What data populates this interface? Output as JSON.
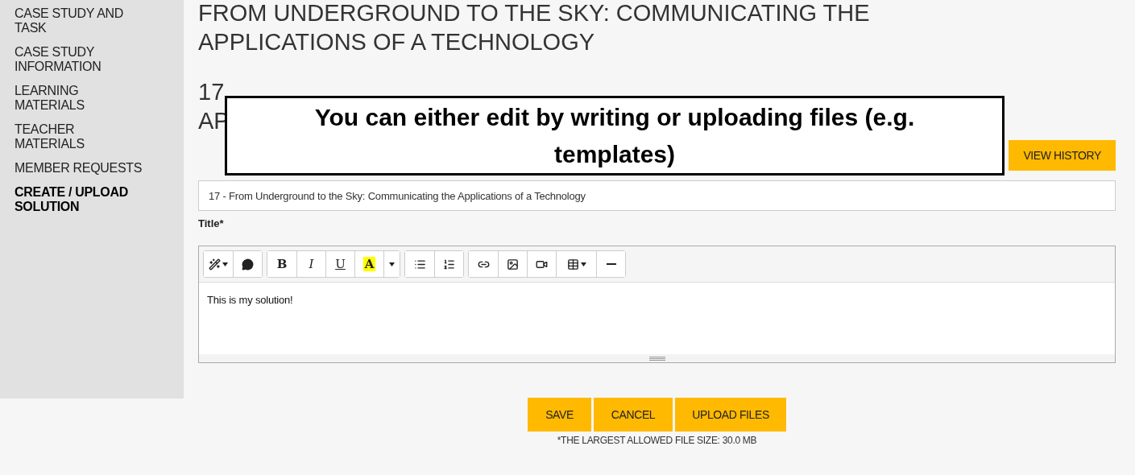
{
  "sidebar": {
    "items": [
      {
        "label": "CASE STUDY AND TASK",
        "selected": false
      },
      {
        "label": "CASE STUDY INFORMATION",
        "selected": false
      },
      {
        "label": "LEARNING MATERIALS",
        "selected": false
      },
      {
        "label": "TEACHER MATERIALS",
        "selected": false
      },
      {
        "label": "MEMBER REQUESTS",
        "selected": false
      },
      {
        "label": "CREATE / UPLOAD SOLUTION",
        "selected": true
      }
    ]
  },
  "page_title": "FROM UNDERGROUND TO THE SKY: COMMUNICATING THE APPLICATIONS OF A TECHNOLOGY",
  "solution_heading": {
    "line_1": "17",
    "line_2": "AP"
  },
  "callout": {
    "text": "You can either edit by writing or uploading files (e.g. templates)"
  },
  "view_history_button": "VIEW HISTORY",
  "title_field": {
    "value": "17 - From Underground to the Sky: Communicating the Applications of a Technology",
    "label": "Title*"
  },
  "editor": {
    "format_letters": [
      "B",
      "I",
      "U",
      "A"
    ],
    "content": "This is my solution!"
  },
  "buttons": [
    "SAVE",
    "CANCEL",
    "UPLOAD FILES"
  ],
  "note": "*THE LARGEST ALLOWED FILE SIZE: 30.0 MB"
}
